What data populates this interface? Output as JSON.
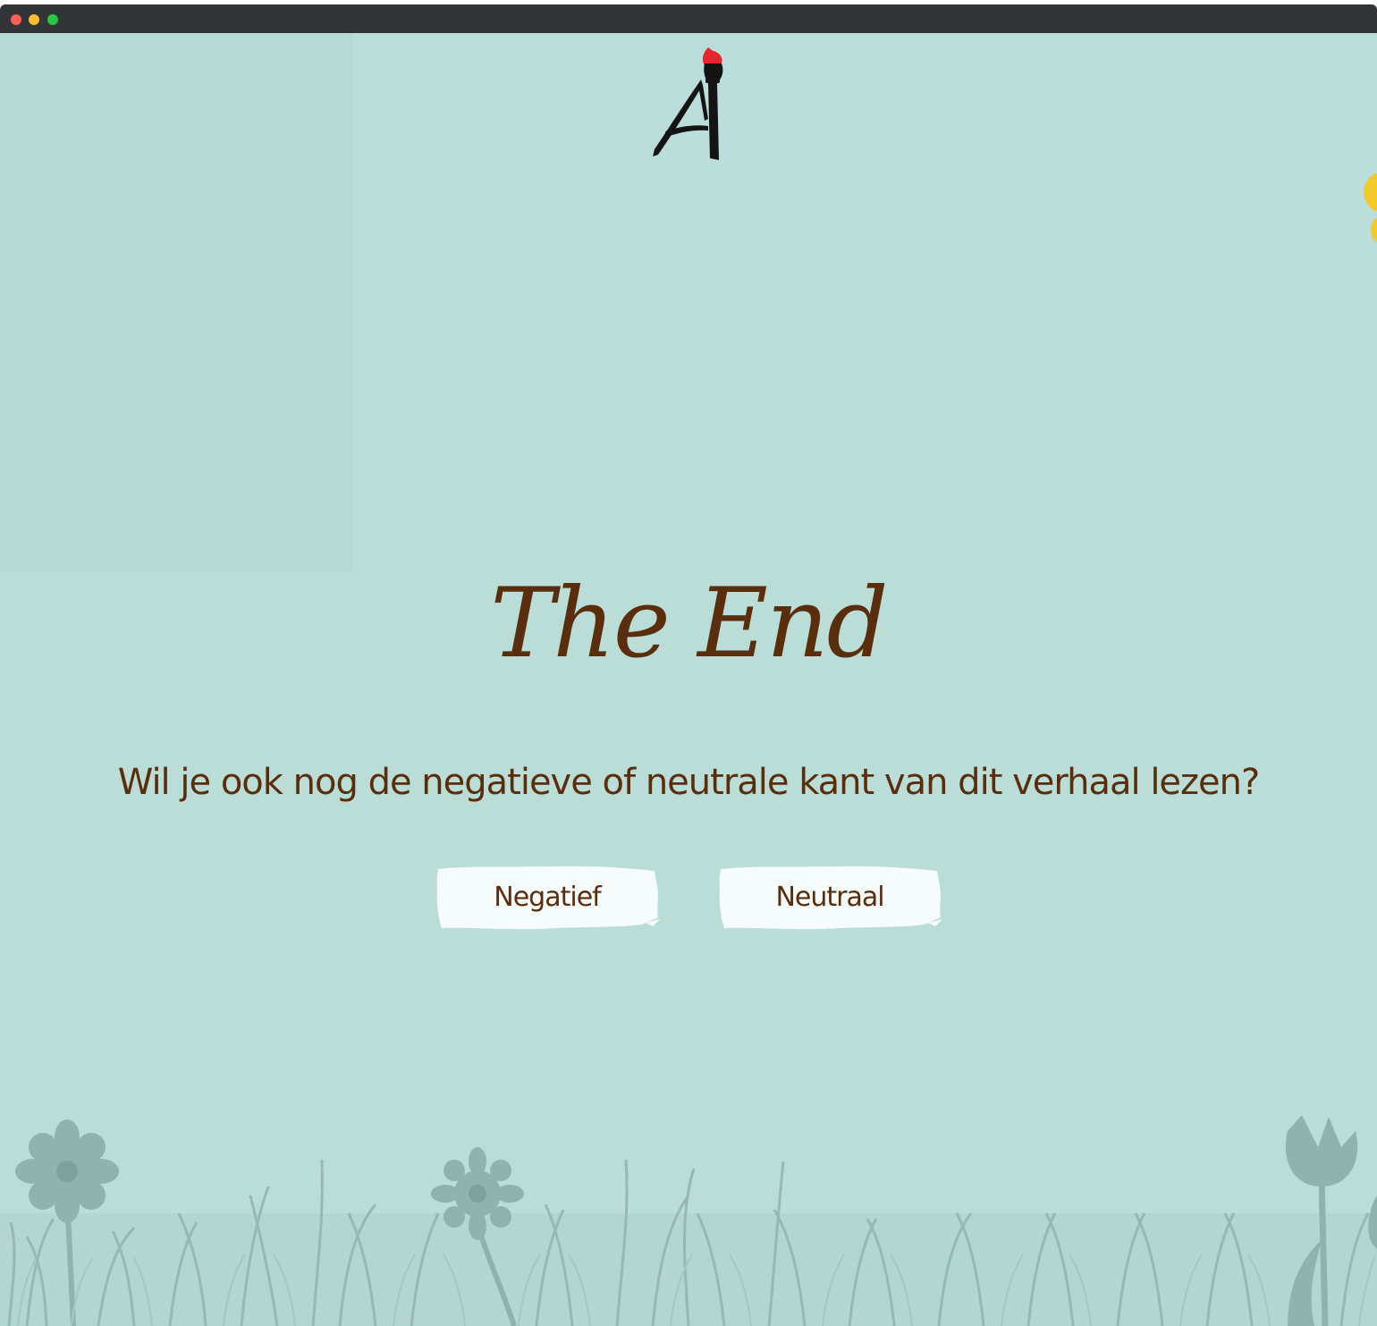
{
  "window": {
    "controls": [
      "close",
      "minimize",
      "maximize"
    ]
  },
  "logo": {
    "icon": "paintbrush-letter-a-logo",
    "accent_color": "#e8252b"
  },
  "story": {
    "title": "The End",
    "question": "Wil je ook nog de negatieve of neutrale kant van dit verhaal lezen?"
  },
  "choices": [
    {
      "label": "Negatief"
    },
    {
      "label": "Neutraal"
    }
  ],
  "colors": {
    "background": "#bbddd8",
    "text": "#5a2e0c",
    "button": "#f6fbfb",
    "plants": "#8fb3ae"
  }
}
